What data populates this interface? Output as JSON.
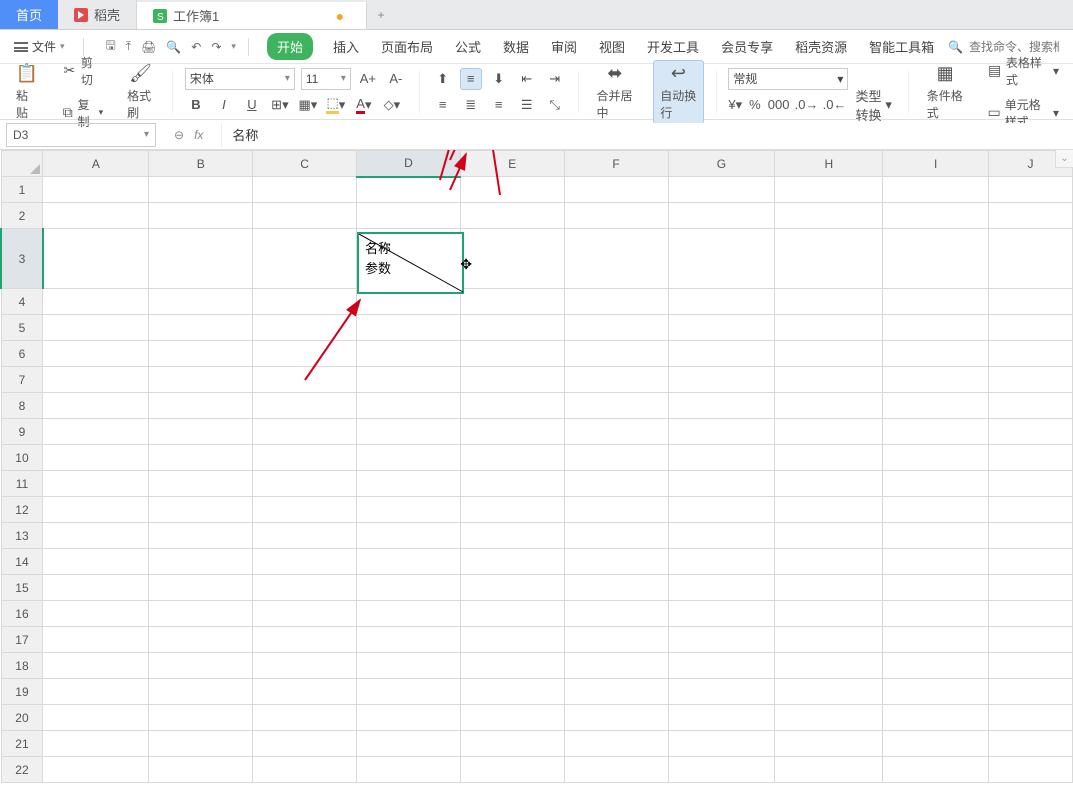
{
  "tabs": {
    "home": "首页",
    "docer": "稻壳",
    "workbook": "工作簿1",
    "modified_dot": "●",
    "plus": "+"
  },
  "menu": {
    "file": "文件",
    "tabs": {
      "start": "开始",
      "insert": "插入",
      "layout": "页面布局",
      "formula": "公式",
      "data": "数据",
      "review": "审阅",
      "view": "视图",
      "devtools": "开发工具",
      "member": "会员专享",
      "docer_res": "稻壳资源",
      "smart": "智能工具箱"
    },
    "search_placeholder": "查找命令、搜索框"
  },
  "ribbon": {
    "paste": "粘贴",
    "cut": "剪切",
    "copy": "复制",
    "format_painter": "格式刷",
    "font_name": "宋体",
    "font_size": "11",
    "increase_font": "A+",
    "decrease_font": "A-",
    "merge_center": "合并居中",
    "auto_wrap": "自动换行",
    "number_format": "常规",
    "type_convert": "类型转换",
    "cond_format": "条件格式",
    "table_style": "表格样式",
    "cell_style": "单元格样式"
  },
  "formula": {
    "cell_ref": "D3",
    "fx": "fx",
    "value": "名称"
  },
  "sheet": {
    "columns": [
      "A",
      "B",
      "C",
      "D",
      "E",
      "F",
      "G",
      "H",
      "I",
      "J"
    ],
    "rows": [
      "1",
      "2",
      "3",
      "4",
      "5",
      "6",
      "7",
      "8",
      "9",
      "10",
      "11",
      "12",
      "13",
      "14",
      "15",
      "16",
      "17",
      "18",
      "19",
      "20",
      "21",
      "22"
    ],
    "selected_col": "D",
    "selected_row": "3",
    "cell_d3_line1": "名称",
    "cell_d3_line2": "参数"
  }
}
